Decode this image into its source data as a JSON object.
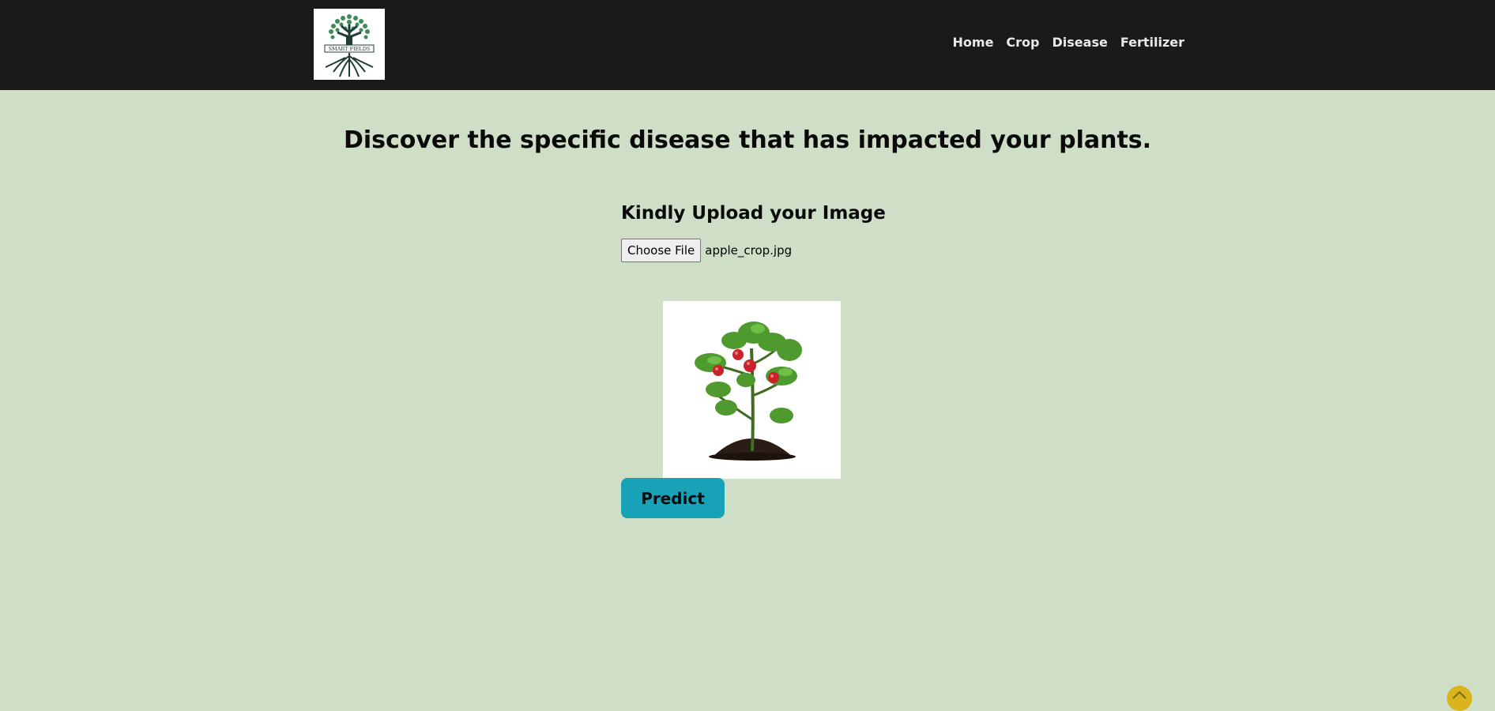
{
  "header": {
    "logo_text": "SMART FIELDS",
    "nav": [
      {
        "label": "Home"
      },
      {
        "label": "Crop"
      },
      {
        "label": "Disease"
      },
      {
        "label": "Fertilizer"
      }
    ]
  },
  "main": {
    "title": "Discover the specific disease that has impacted your plants.",
    "upload_heading": "Kindly Upload your Image",
    "file_input": {
      "button_label": "Choose File",
      "file_name": "apple_crop.jpg"
    },
    "predict_label": "Predict"
  },
  "colors": {
    "navbar_bg": "#1a1a1a",
    "page_bg": "#cfdfc7",
    "predict_bg": "#17a2b8",
    "scroll_top_bg": "#d9b41c"
  },
  "icons": {
    "scroll_top": "chevron-up-icon",
    "logo": "tree-roots-logo"
  }
}
